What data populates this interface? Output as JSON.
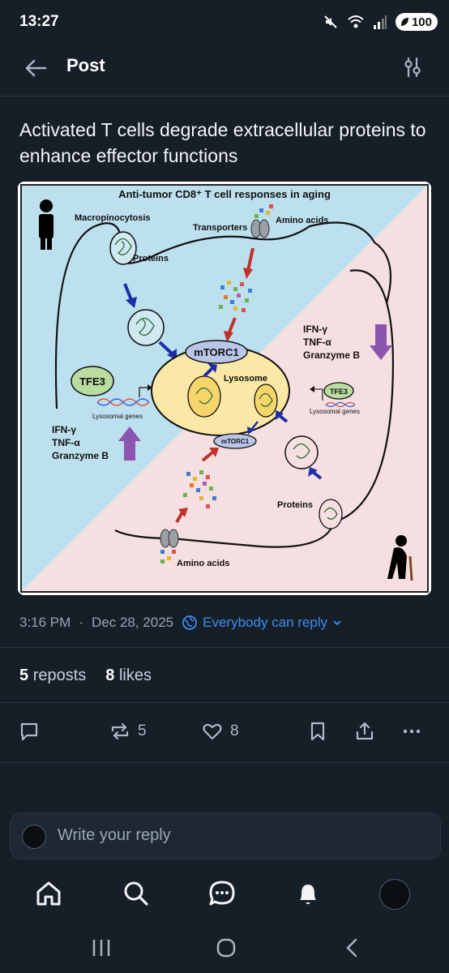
{
  "status_bar": {
    "time": "13:27",
    "battery": "100"
  },
  "header": {
    "title": "Post"
  },
  "post": {
    "title": "Activated T cells degrade extracellular proteins to enhance effector functions",
    "figure": {
      "title": "Anti-tumor CD8⁺ T cell responses in aging",
      "labels": {
        "macropinocytosis": "Macropinocytosis",
        "proteins_top": "Proteins",
        "transporters": "Transporters",
        "amino_acids_top": "Amino acids",
        "mtorc1_main": "mTORC1",
        "lysosome": "Lysosome",
        "tfe3_left": "TFE3",
        "lysosomal_genes_left": "Lysosomal genes",
        "tfe3_right": "TFE3",
        "lysosomal_genes_right": "Lysosomal genes",
        "mtorc1_small": "mTORC1",
        "proteins_bottom": "Proteins",
        "amino_acids_bottom": "Amino acids",
        "ifn_left": "IFN-γ",
        "tnf_left": "TNF-α",
        "granzyme_left": "Granzyme B",
        "ifn_right": "IFN-γ",
        "tnf_right": "TNF-α",
        "granzyme_right": "Granzyme B"
      },
      "colors": {
        "young_bg": "#bde0ee",
        "aged_bg": "#f5dfe1",
        "lysosome": "#fce8a6",
        "tfe3": "#b9dc9f",
        "mtorc1": "#b9c6e8",
        "up_arrow": "#8b55b0"
      }
    },
    "timestamp": "3:16 PM",
    "date": "Dec 28, 2025",
    "reply_permission": "Everybody can reply",
    "reposts_count": "5",
    "reposts_label": "reposts",
    "likes_count": "8",
    "likes_label": "likes"
  },
  "actions": {
    "repost_count": "5",
    "like_count": "8"
  },
  "reply": {
    "placeholder": "Write your reply"
  },
  "icons": [
    "back-arrow-icon",
    "filter-icon",
    "globe-icon",
    "chevron-down-icon",
    "comment-icon",
    "repost-icon",
    "heart-icon",
    "bookmark-icon",
    "share-icon",
    "more-icon",
    "home-icon",
    "search-icon",
    "messages-icon",
    "bell-icon"
  ],
  "accent": "#3d8df0"
}
